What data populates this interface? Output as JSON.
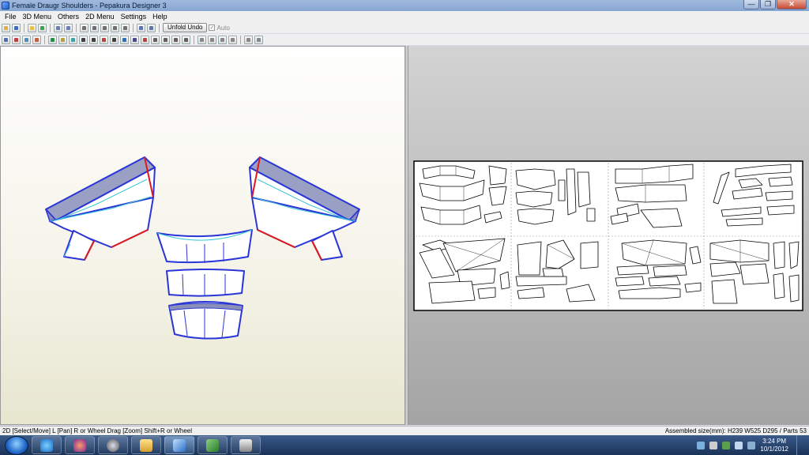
{
  "window": {
    "title": "Female Draugr Shoulders - Pepakura Designer 3",
    "minimize": "—",
    "maximize": "❐",
    "close": "✕"
  },
  "menubar": {
    "items": [
      "File",
      "3D Menu",
      "Others",
      "2D Menu",
      "Settings",
      "Help"
    ]
  },
  "toolbar": {
    "unfold_undo_label": "Unfold Undo",
    "auto_label": "Auto",
    "auto_checked": "✓"
  },
  "statusbar": {
    "left": "2D [Select/Move] L [Pan] R or Wheel Drag [Zoom] Shift+R or Wheel",
    "right": "Assembled size(mm): H239 W525 D295 / Parts 53"
  },
  "taskbar": {
    "time": "3:24 PM",
    "date": "10/1/2012"
  },
  "colors": {
    "edge_blue": "#2a35d8",
    "edge_red": "#e01a1a",
    "fold_cyan": "#3cc6d6",
    "face_fill": "#ffffff",
    "shade_fill": "#8a8fb8"
  }
}
